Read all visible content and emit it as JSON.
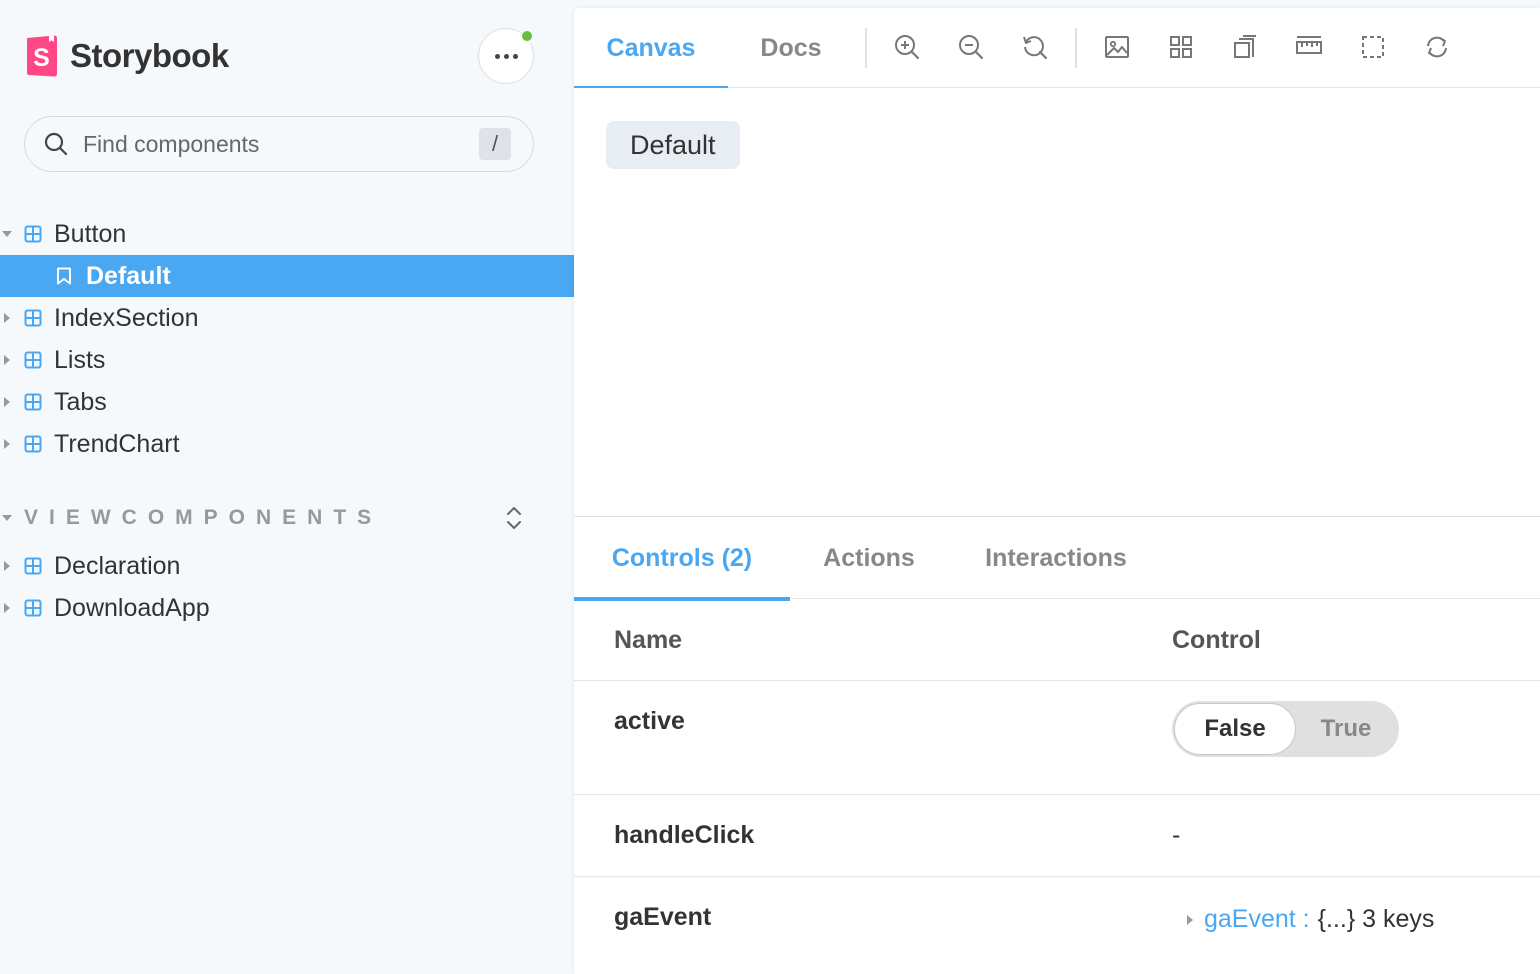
{
  "colors": {
    "accent": "#4aa7f2",
    "brand": "#ff4785",
    "status_ok": "#66bf3c"
  },
  "sidebar": {
    "brand_name": "Storybook",
    "search": {
      "placeholder": "Find components",
      "shortcut": "/"
    },
    "tree": [
      {
        "label": "Button",
        "icon": "component-icon",
        "expanded": true
      },
      {
        "label": "Default",
        "icon": "bookmark-icon",
        "selected": true
      },
      {
        "label": "IndexSection",
        "icon": "component-icon"
      },
      {
        "label": "Lists",
        "icon": "component-icon"
      },
      {
        "label": "Tabs",
        "icon": "component-icon"
      },
      {
        "label": "TrendChart",
        "icon": "component-icon"
      }
    ],
    "section": {
      "title": "VIEWCOMPONENTS",
      "items": [
        {
          "label": "Declaration",
          "icon": "component-icon"
        },
        {
          "label": "DownloadApp",
          "icon": "component-icon"
        }
      ]
    }
  },
  "toolbar": {
    "tabs": [
      "Canvas",
      "Docs"
    ],
    "tools": [
      "zoom-in-icon",
      "zoom-out-icon",
      "zoom-reset-icon",
      "background-icon",
      "grid-icon",
      "viewport-icon",
      "measure-icon",
      "outline-icon",
      "remount-icon"
    ]
  },
  "canvas": {
    "preview_button": "Default"
  },
  "addons": {
    "tabs": [
      "Controls (2)",
      "Actions",
      "Interactions"
    ],
    "table": {
      "headers": {
        "name": "Name",
        "control": "Control"
      },
      "rows": [
        {
          "name": "active",
          "options": [
            "False",
            "True"
          ],
          "selected": "False"
        },
        {
          "name": "handleClick",
          "value": "-"
        },
        {
          "name": "gaEvent",
          "object_key": "gaEvent :",
          "object_value": "{...} 3 keys"
        }
      ]
    }
  }
}
